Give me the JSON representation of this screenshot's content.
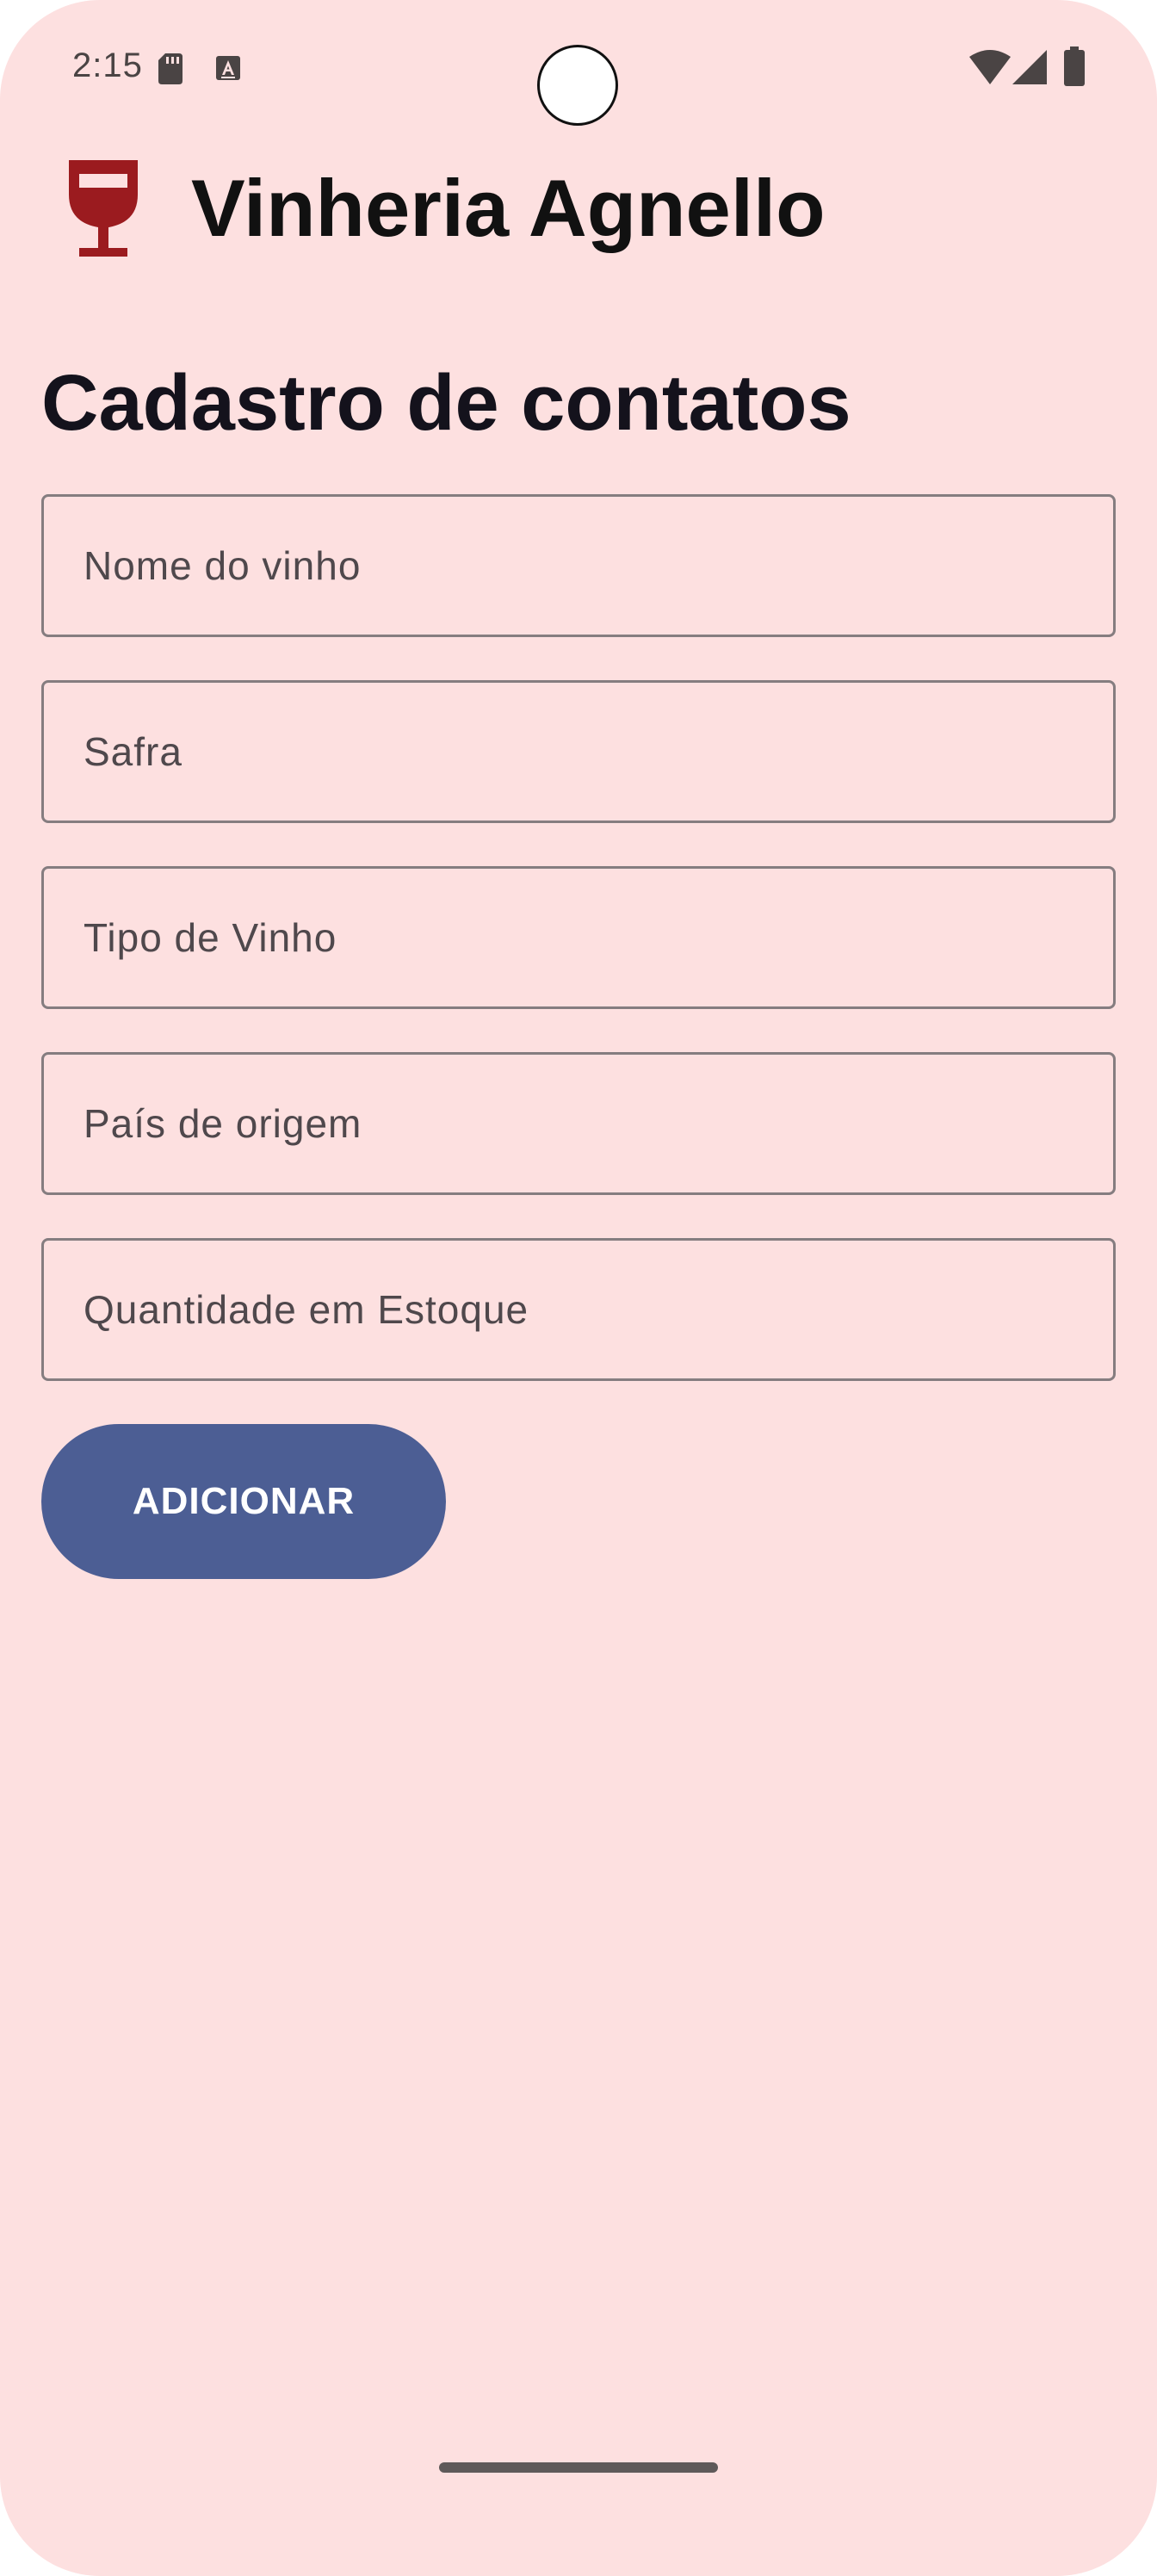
{
  "status_bar": {
    "time": "2:15",
    "icons": [
      "sd-card-icon",
      "accessibility-a-icon",
      "wifi-icon",
      "cell-signal-icon",
      "battery-icon"
    ]
  },
  "header": {
    "app_icon": "wine-glass-icon",
    "app_title": "Vinheria Agnello"
  },
  "page": {
    "title": "Cadastro de contatos"
  },
  "form": {
    "fields": [
      {
        "placeholder": "Nome do vinho",
        "value": ""
      },
      {
        "placeholder": "Safra",
        "value": ""
      },
      {
        "placeholder": "Tipo de Vinho",
        "value": ""
      },
      {
        "placeholder": "País de origem",
        "value": ""
      },
      {
        "placeholder": "Quantidade em Estoque",
        "value": ""
      }
    ],
    "submit_label": "ADICIONAR"
  },
  "colors": {
    "background": "#fde0e0",
    "button": "#4c5e94",
    "wine_icon": "#9b1b1f",
    "field_border": "#857d80"
  }
}
